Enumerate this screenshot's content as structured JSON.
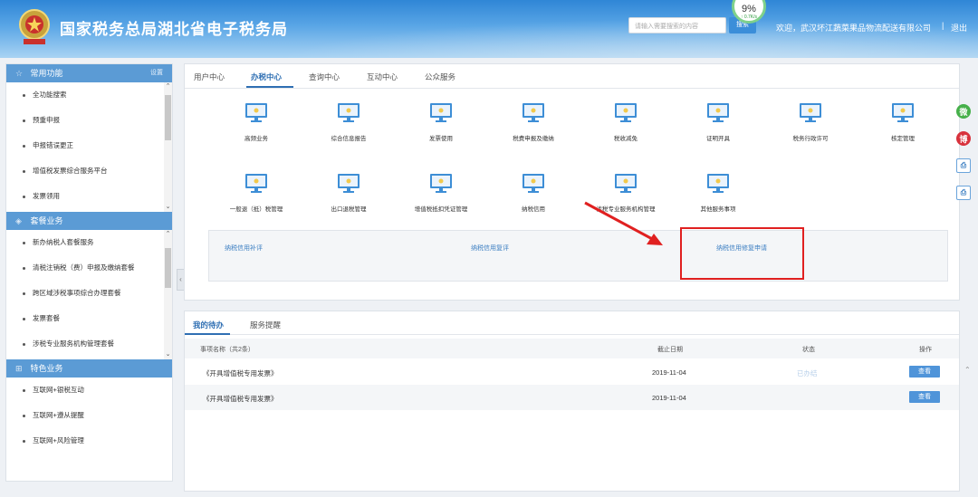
{
  "header": {
    "site_title": "国家税务总局湖北省电子税务局",
    "search_placeholder": "请输入需要搜索的内容",
    "search_button": "搜索",
    "gauge_percent": "9%",
    "gauge_speed": "↑ 0.7K/s",
    "welcome": "欢迎，武汉坏江蔬菜果品物流配送有限公司",
    "separator": "|",
    "logout": "退出",
    "logo_text": "税"
  },
  "sidebar": {
    "sections": [
      {
        "title": "常用功能",
        "setting": "设置",
        "icon": "star-icon",
        "items": [
          "全功能搜索",
          "预重申报",
          "申报错误更正",
          "增值税发票综合服务平台",
          "发票领用"
        ]
      },
      {
        "title": "套餐业务",
        "icon": "layers-icon",
        "items": [
          "新办纳税人套餐服务",
          "清税注销税（费）申报及缴纳套餐",
          "跨区域涉税事项综合办理套餐",
          "发票套餐",
          "涉税专业服务机构管理套餐"
        ]
      },
      {
        "title": "特色业务",
        "icon": "grid-icon",
        "items": [
          "互联网+银税互动",
          "互联网+遵从提醒",
          "互联网+风险管理"
        ]
      }
    ],
    "collapse_glyph": "‹",
    "scroll_up": "⌃",
    "scroll_down": "⌄"
  },
  "main": {
    "tabs": [
      "用户中心",
      "办税中心",
      "查询中心",
      "互动中心",
      "公众服务"
    ],
    "active_tab": "办税中心",
    "grid": [
      "高频业务",
      "综合信息报告",
      "发票使用",
      "税费申报及缴纳",
      "税收减免",
      "证明开具",
      "税务行政许可",
      "核定管理",
      "一般退（抵）税管理",
      "出口退税管理",
      "增值税抵扣凭证管理",
      "纳税信用",
      "涉税专业服务机构管理",
      "其他服务事项"
    ],
    "sub_links": [
      "纳税信用补评",
      "纳税信用复评",
      "纳税信用修复申请"
    ],
    "highlight_color": "#e02020"
  },
  "todo": {
    "tabs": [
      "我的待办",
      "服务提醒"
    ],
    "headers": {
      "name": "事项名称（共2条）",
      "deadline": "截止日期",
      "status": "状态",
      "action": "操作"
    },
    "rows": [
      {
        "name": "《开具增值税专用发票》",
        "deadline": "2019-11-04",
        "status": "已办结",
        "action": "查看"
      },
      {
        "name": "《开具增值税专用发票》",
        "deadline": "2019-11-04",
        "status": "",
        "action": "查看"
      }
    ]
  },
  "right_icons": {
    "wechat": "微",
    "weibo": "博",
    "print1": "⎙",
    "print2": "⎙"
  },
  "colors": {
    "primary": "#2f6fb3",
    "section_head": "#5b9bd5",
    "button": "#4f94d9"
  }
}
